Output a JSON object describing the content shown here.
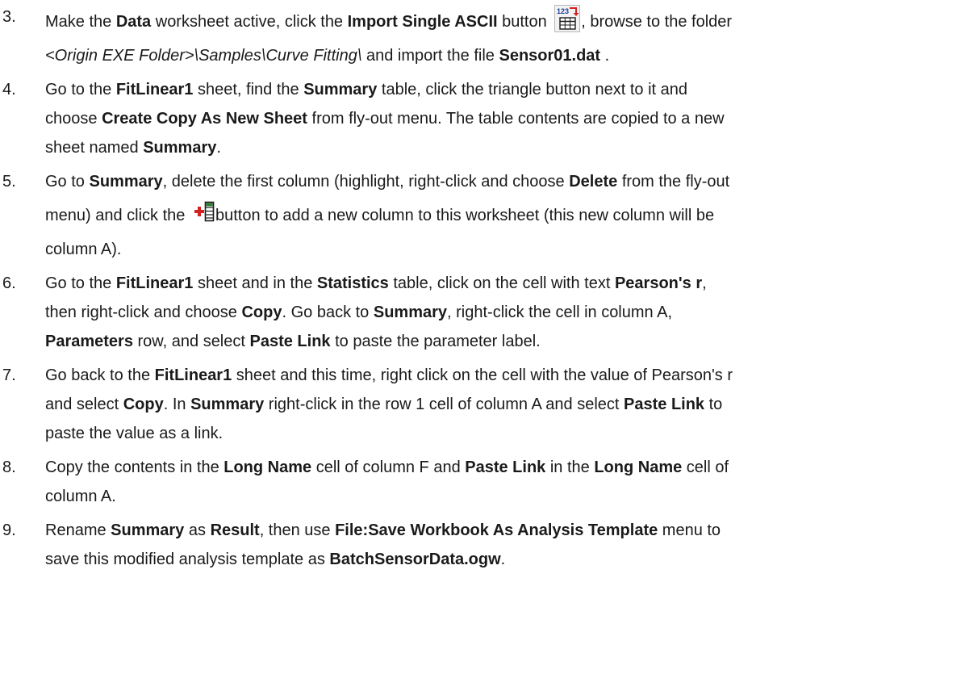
{
  "steps": [
    {
      "num": "3.",
      "line1": {
        "t1": "Make the ",
        "b1": "Data",
        "t2": " worksheet active, click the ",
        "b2": "Import Single ASCII",
        "t3": " button ",
        "t4": ", browse to the folder"
      },
      "line2": {
        "i1": "<Origin EXE Folder>\\Samples\\Curve Fitting\\",
        "t1": " and import the file ",
        "b1": "Sensor01.dat",
        "t2": " ."
      },
      "icon": "import-single-ascii-icon"
    },
    {
      "num": "4.",
      "line1": {
        "t1": "Go to the ",
        "b1": "FitLinear1",
        "t2": " sheet, find the ",
        "b2": "Summary",
        "t3": " table, click the triangle button next to it and"
      },
      "line2": {
        "t1": "choose ",
        "b1": "Create Copy As New Sheet",
        "t2": " from fly-out menu. The table contents are copied to a new"
      },
      "line3": {
        "t1": "sheet named ",
        "b1": "Summary",
        "t2": "."
      }
    },
    {
      "num": "5.",
      "line1": {
        "t1": "Go to ",
        "b1": "Summary",
        "t2": ", delete the first column (highlight, right-click and choose ",
        "b2": "Delete",
        "t3": " from the fly-out"
      },
      "line2": {
        "t1": "menu) and click the ",
        "t2": "button to add a new column to this worksheet (this new column will be"
      },
      "line3": {
        "t1": "column A)."
      },
      "icon": "add-column-icon"
    },
    {
      "num": "6.",
      "line1": {
        "t1": "Go to the ",
        "b1": "FitLinear1",
        "t2": " sheet and in the ",
        "b2": "Statistics",
        "t3": " table, click on the cell with text ",
        "b3": "Pearson's r",
        "t4": ","
      },
      "line2": {
        "t1": "then right-click and choose ",
        "b1": "Copy",
        "t2": ". Go back to ",
        "b2": "Summary",
        "t3": ", right-click the cell in column A,"
      },
      "line3": {
        "b1": "Parameters",
        "t1": " row, and select ",
        "b2": "Paste Link",
        "t2": " to paste the parameter label."
      }
    },
    {
      "num": "7.",
      "line1": {
        "t1": "Go back to the ",
        "b1": "FitLinear1",
        "t2": " sheet and this time, right click on the cell with the value of Pearson's r"
      },
      "line2": {
        "t1": "and select ",
        "b1": "Copy",
        "t2": ". In ",
        "b2": "Summary",
        "t3": " right-click in the row 1 cell of column A and select ",
        "b3": "Paste Link",
        "t4": " to"
      },
      "line3": {
        "t1": "paste the value as a link."
      }
    },
    {
      "num": "8.",
      "line1": {
        "t1": "Copy the contents in the ",
        "b1": "Long Name",
        "t2": " cell of column F and ",
        "b2": "Paste Link",
        "t3": " in the ",
        "b3": "Long Name",
        "t4": " cell of"
      },
      "line2": {
        "t1": "column A."
      }
    },
    {
      "num": "9.",
      "line1": {
        "t1": "Rename ",
        "b1": "Summary",
        "t2": " as ",
        "b2": "Result",
        "t3": ", then use ",
        "b3": "File:Save Workbook As Analysis Template",
        "t4": " menu to"
      },
      "line2": {
        "t1": "save this modified analysis template as ",
        "b1": "BatchSensorData.ogw",
        "t2": "."
      }
    }
  ],
  "icons": {
    "import_label": "123",
    "accent_red": "#d42020",
    "accent_green": "#2e7d32"
  }
}
